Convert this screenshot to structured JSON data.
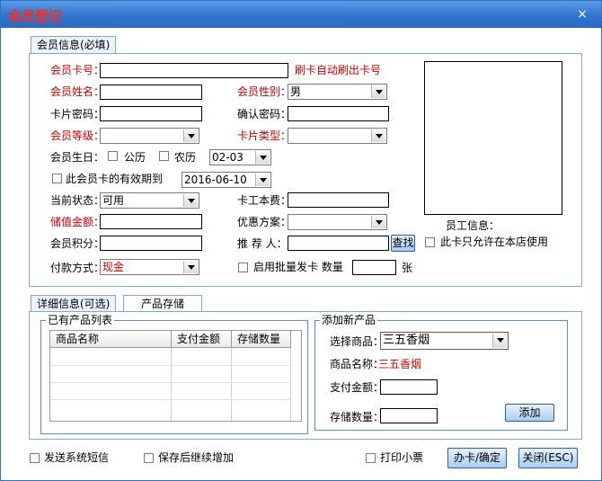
{
  "window": {
    "title": "会员登记",
    "close_symbol": "×"
  },
  "tabs_top": {
    "member_info": "会员信息(必填)"
  },
  "form": {
    "card_no_label": "会员卡号：",
    "card_no_hint": "刷卡自动刷出卡号",
    "name_label": "会员姓名：",
    "gender_label": "会员性别：",
    "gender_value": "男",
    "card_pwd_label": "卡片密码：",
    "confirm_pwd_label": "确认密码：",
    "level_label": "会员等级：",
    "level_value": "",
    "card_type_label": "卡片类型：",
    "card_type_value": "",
    "birthday_label": "会员生日：",
    "solar_label": "公历",
    "lunar_label": "农历",
    "birthday_value": "02-03",
    "validity_label": "此会员卡的有效期到",
    "validity_value": "2016-06-10",
    "status_label": "当前状态：",
    "status_value": "可用",
    "card_fee_label": "卡工本费：",
    "stored_label": "储值金额：",
    "discount_label": "优惠方案：",
    "discount_value": "",
    "points_label": "会员积分：",
    "referrer_label": "推 荐 人：",
    "search_button": "查找",
    "pay_label": "付款方式：",
    "pay_value": "现金",
    "batch_label": "启用批量发卡 数量",
    "batch_unit": "张",
    "staff_info_label": "员工信息：",
    "store_only_label": "此卡只允许在本店使用"
  },
  "tabs_bottom": {
    "detail": "详细信息(可选)",
    "product_storage": "产品存储"
  },
  "product_list": {
    "legend": "已有产品列表",
    "columns": [
      "商品名称",
      "支付金额",
      "存储数量"
    ]
  },
  "add_product": {
    "legend": "添加新产品",
    "select_label": "选择商品：",
    "select_value": "三五香烟",
    "name_label": "商品名称：",
    "name_value": "三五香烟",
    "pay_label": "支付金额：",
    "qty_label": "存储数量：",
    "add_button": "添加"
  },
  "footer": {
    "sms_label": "发送系统短信",
    "continue_label": "保存后继续增加",
    "print_label": "打印小票",
    "confirm_button": "办卡/确定",
    "close_button": "关闭(ESC)"
  }
}
